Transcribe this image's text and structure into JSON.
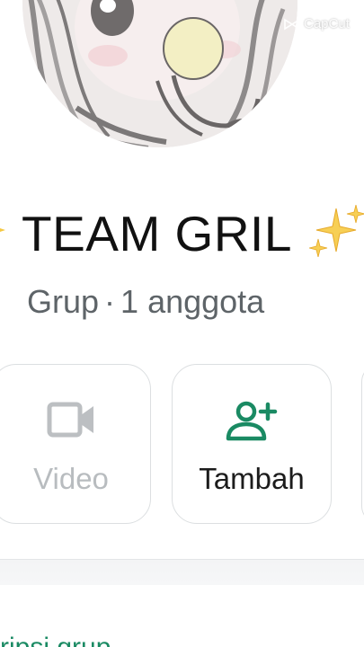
{
  "watermark": {
    "text": "CapCut",
    "icon": "capcut-logo-icon"
  },
  "profile": {
    "avatar_icon": "anime-girl-avatar",
    "group_name": "TEAM GRIL",
    "decoration_icon": "sparkles-icon",
    "type_label": "Grup",
    "separator": "·",
    "member_count": "1 anggota"
  },
  "actions": [
    {
      "label": "Video",
      "icon": "video-camera-icon",
      "enabled": false
    },
    {
      "label": "Tambah",
      "icon": "add-person-icon",
      "enabled": true
    }
  ],
  "colors": {
    "accent_green": "#1a8a63",
    "disabled_gray": "#b8bcbf",
    "subtitle_gray": "#5e6468",
    "sparkle_yellow": "#f5c842"
  },
  "section_peek": {
    "text": "ripsi grup"
  }
}
